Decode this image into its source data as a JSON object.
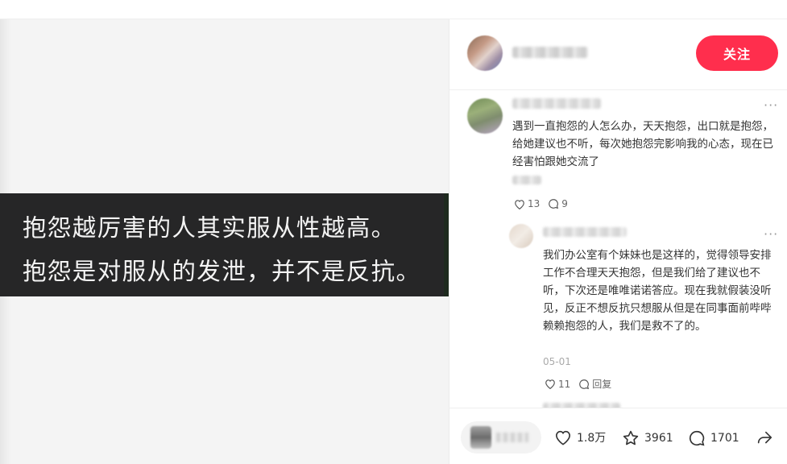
{
  "post": {
    "caption_lines": [
      "抱怨越厉害的人其实服从性越高。",
      "抱怨是对服从的发泄，并不是反抗。"
    ]
  },
  "author": {
    "follow_label": "关注"
  },
  "comments": [
    {
      "text": "遇到一直抱怨的人怎么办，天天抱怨，出口就是抱怨，给她建议也不听，每次她抱怨完影响我的心态，现在已经害怕跟她交流了",
      "likes": "13",
      "replies": "9"
    },
    {
      "text": "我们办公室有个妹妹也是这样的，觉得领导安排工作不合理天天抱怨，但是我们给了建议也不听，下次还是唯唯诺诺答应。现在我就假装没听见，反正不想反抗只想服从但是在同事面前哔哔赖赖抱怨的人，我们是救不了的。",
      "date": "05-01",
      "likes": "11",
      "reply_label": "回复"
    }
  ],
  "engagement": {
    "likes": "1.8万",
    "collects": "3961",
    "comments": "1701"
  },
  "icons": {
    "like": "heart-icon",
    "collect": "star-icon",
    "comment": "comment-bubble-icon",
    "share": "share-icon",
    "more": "more-dots-icon"
  },
  "colors": {
    "accent": "#ff2e4d",
    "caption_band": "#262627",
    "media_bg": "#f4f4f4"
  }
}
